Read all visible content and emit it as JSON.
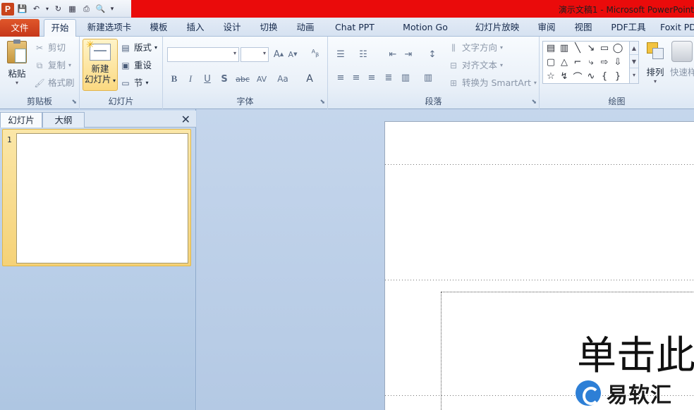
{
  "title_bar": {
    "app_icon_label": "P",
    "title": "演示文稿1 - Microsoft PowerPoint",
    "qat_icons": [
      "save-icon",
      "undo-icon",
      "dropdown-icon",
      "redo-icon",
      "layout-icon",
      "print-icon",
      "preview-icon",
      "customize-icon"
    ]
  },
  "tabs": [
    {
      "label": "文件",
      "type": "file"
    },
    {
      "label": "开始",
      "type": "active"
    },
    {
      "label": "新建选项卡"
    },
    {
      "label": "模板"
    },
    {
      "label": "插入"
    },
    {
      "label": "设计"
    },
    {
      "label": "切换"
    },
    {
      "label": "动画"
    },
    {
      "label": "Chat PPT"
    },
    {
      "label": "Motion Go"
    },
    {
      "label": "幻灯片放映"
    },
    {
      "label": "审阅"
    },
    {
      "label": "视图"
    },
    {
      "label": "PDF工具"
    },
    {
      "label": "Foxit PD"
    }
  ],
  "ribbon": {
    "clipboard": {
      "label": "剪贴板",
      "paste": "粘贴",
      "cut": "剪切",
      "copy": "复制",
      "format_painter": "格式刷"
    },
    "slides": {
      "label": "幻灯片",
      "new_slide_line1": "新建",
      "new_slide_line2": "幻灯片",
      "layout": "版式",
      "reset": "重设",
      "section": "节"
    },
    "font": {
      "label": "字体",
      "font_name": "",
      "font_size": "",
      "buttons": [
        "B",
        "I",
        "U",
        "S",
        "abc",
        "AV",
        "Aa",
        "A"
      ]
    },
    "paragraph": {
      "label": "段落",
      "text_direction": "文字方向",
      "align_text": "对齐文本",
      "convert_smartart": "转换为 SmartArt"
    },
    "drawing": {
      "label": "绘图",
      "arrange": "排列",
      "quick_styles": "快速样"
    }
  },
  "left_pane": {
    "tabs": [
      "幻灯片",
      "大纲"
    ],
    "close": "✕",
    "slide_number": "1"
  },
  "slide": {
    "title_placeholder": "单击此"
  },
  "watermark": {
    "text": "易软汇"
  }
}
